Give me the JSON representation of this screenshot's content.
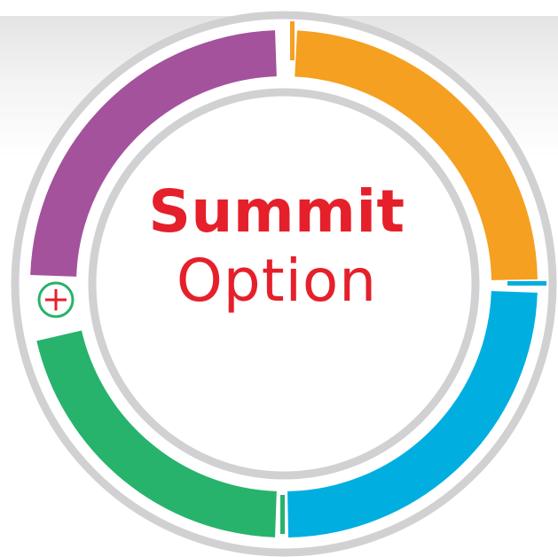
{
  "center": {
    "title": "Summit",
    "subtitle": "Option"
  },
  "segments": [
    {
      "name": "top-left",
      "color": "#a4529c"
    },
    {
      "name": "top-right",
      "color": "#f5a021"
    },
    {
      "name": "bottom-right",
      "color": "#00aee0"
    },
    {
      "name": "bottom-left",
      "color": "#27b36b"
    }
  ],
  "ring_color": "#d1d1d3",
  "text_color": "#e5202b",
  "icons": {
    "plus": "plus-circle-icon"
  }
}
